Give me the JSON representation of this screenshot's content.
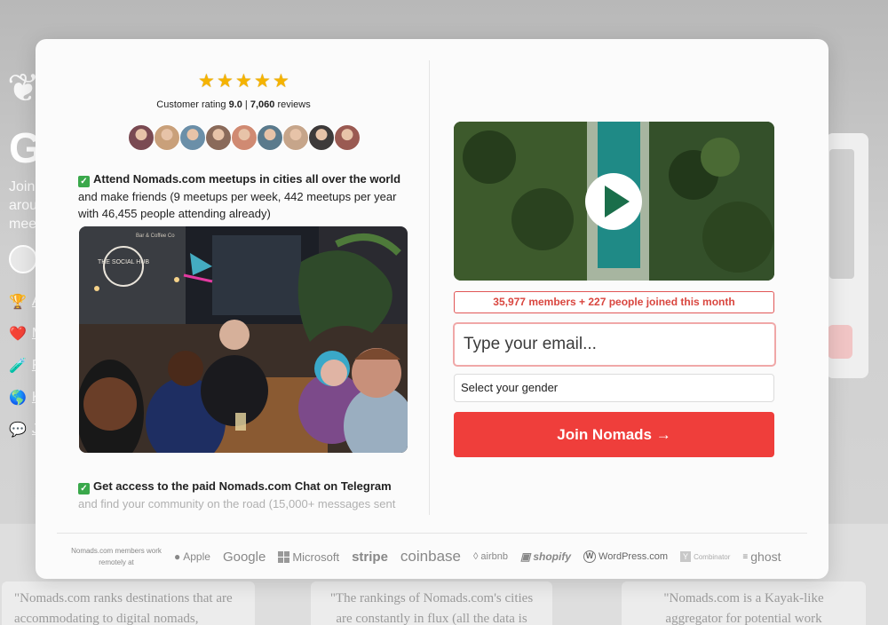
{
  "background": {
    "title": "G",
    "subtitle": "Join arou mee",
    "bullets": [
      {
        "emoji": "🏆",
        "text": "A"
      },
      {
        "emoji": "❤️",
        "text": "M"
      },
      {
        "emoji": "🧪",
        "text": "F"
      },
      {
        "emoji": "🌎",
        "text": "K"
      },
      {
        "emoji": "💬",
        "text": "J"
      }
    ],
    "quotes": [
      "\"Nomads.com ranks destinations that are accommodating to digital nomads,",
      "\"The rankings of Nomads.com's cities are constantly in flux (all the data is",
      "\"Nomads.com is a Kayak-like aggregator for potential work"
    ]
  },
  "rating": {
    "stars": "★★★★★",
    "prefix": "Customer rating ",
    "score": "9.0",
    "separator": " | ",
    "reviews_count": "7,060",
    "reviews_suffix": " reviews"
  },
  "avatar_colors": [
    "#7a4a52",
    "#c9a07a",
    "#6b8fa8",
    "#8a6a5a",
    "#d08a72",
    "#5a7a8c",
    "#c6a58a",
    "#3d3a3a",
    "#9a5a52"
  ],
  "features": [
    {
      "check": "✓",
      "highlight": "Attend Nomads.com meetups in cities all over the world",
      "text": "and make friends (9 meetups per week, 442 meetups per year with 46,455 people attending already)"
    },
    {
      "check": "✓",
      "highlight": "Get access to the paid Nomads.com Chat on Telegram",
      "text": "and find your community on the road (15,000+ messages sent"
    }
  ],
  "photo": {
    "sign": "THE SOCIAL HUB",
    "sign_small": "Bar & Coffee Co"
  },
  "members_text": "35,977 members + 227 people joined this month",
  "email_placeholder": "Type your email...",
  "gender_label": "Select your gender",
  "join_label": "Join Nomads →",
  "logos_label": "Nomads.com members work remotely at",
  "logos": [
    "Apple",
    "Google",
    "Microsoft",
    "stripe",
    "coinbase",
    "airbnb",
    "shopify",
    "WordPress.com",
    "Combinator",
    "ghost"
  ],
  "colors": {
    "accent": "#ef3e3b",
    "check": "#3aa84b",
    "star": "#f5b301"
  }
}
